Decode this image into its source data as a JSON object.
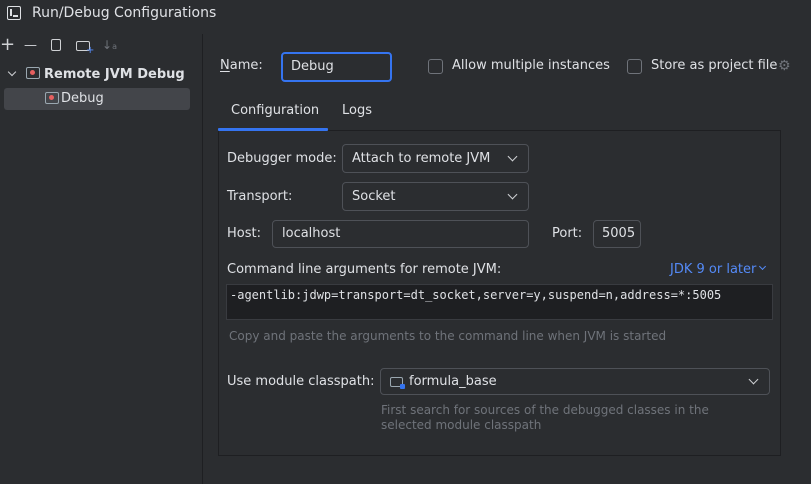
{
  "window": {
    "title": "Run/Debug Configurations"
  },
  "toolbar": {
    "add": "+",
    "remove": "—",
    "copy": "⧉",
    "folder": "📁",
    "sort": "↓a"
  },
  "tree": {
    "root_label": "Remote JVM Debug",
    "child_label": "Debug"
  },
  "header": {
    "name_label": "Name:",
    "name_value": "Debug",
    "allow_multiple_label": "Allow multiple instances",
    "allow_multiple_checked": false,
    "store_label": "Store as project file",
    "store_checked": false
  },
  "tabs": [
    {
      "label": "Configuration",
      "active": true
    },
    {
      "label": "Logs",
      "active": false
    }
  ],
  "config": {
    "debugger_mode_label": "Debugger mode:",
    "debugger_mode_value": "Attach to remote JVM",
    "transport_label": "Transport:",
    "transport_value": "Socket",
    "host_label": "Host:",
    "host_value": "localhost",
    "port_label": "Port:",
    "port_value": "5005",
    "cmd_label": "Command line arguments for remote JVM:",
    "jdk_link": "JDK 9 or later",
    "cmd_value": "-agentlib:jdwp=transport=dt_socket,server=y,suspend=n,address=*:5005",
    "cmd_hint": "Copy and paste the arguments to the command line when JVM is started",
    "module_label": "Use module classpath:",
    "module_value": "formula_base",
    "module_hint": "First search for sources of the debugged classes in the selected module classpath"
  },
  "colors": {
    "background": "#2b2d30",
    "accent": "#3574f0",
    "link": "#548af7",
    "selection": "#43454a"
  }
}
